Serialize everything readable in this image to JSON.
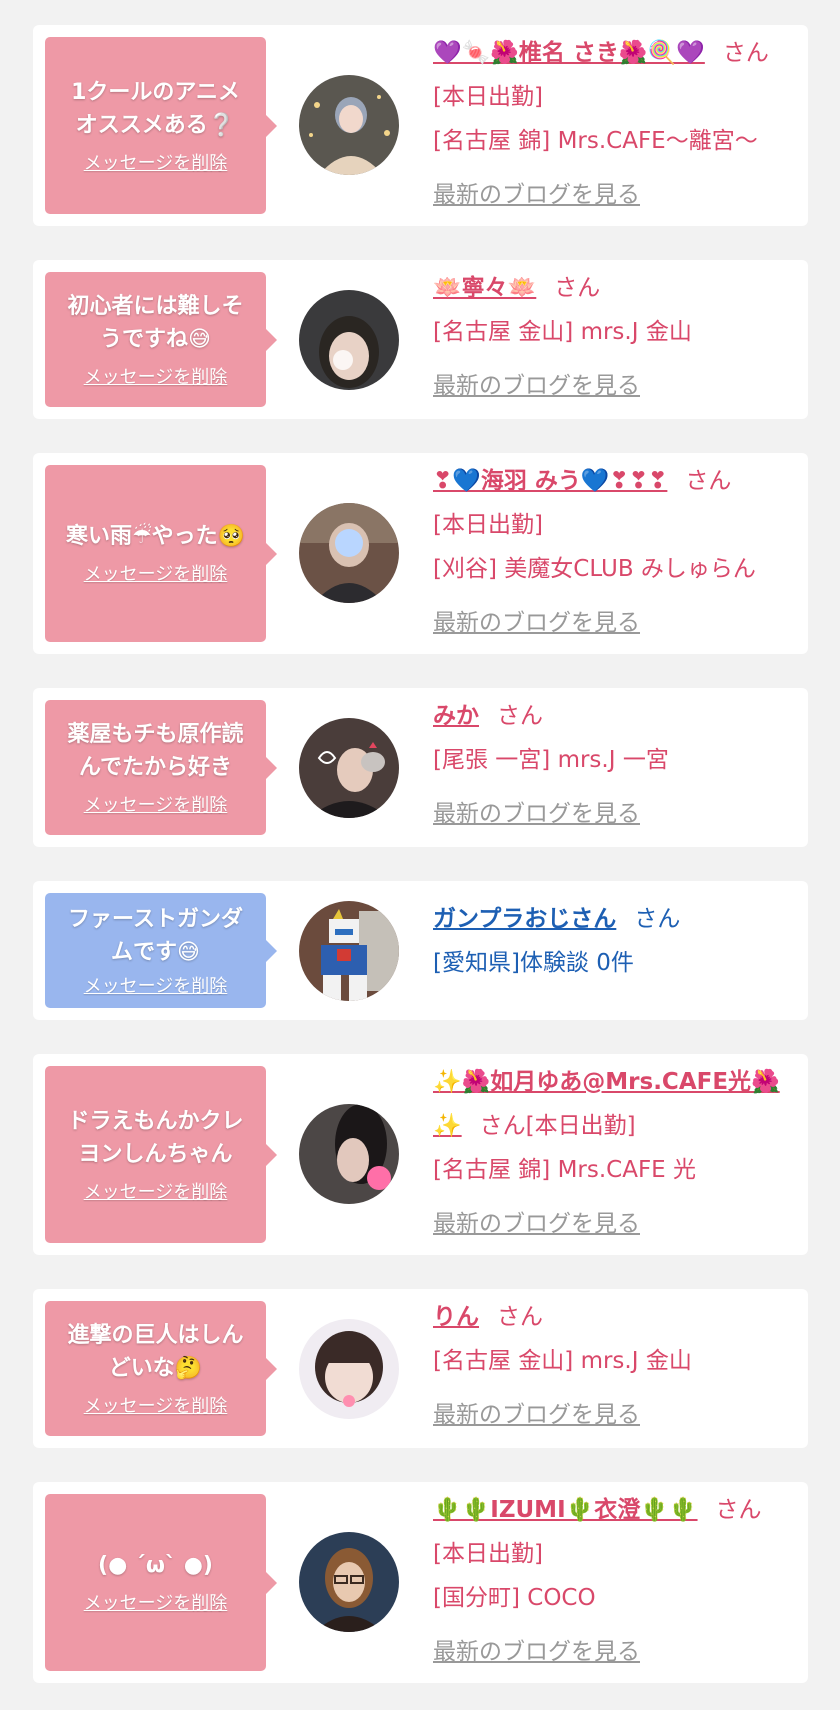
{
  "delete_label": "メッセージを削除",
  "blog_label": "最新のブログを見る",
  "colors": {
    "page_bg": "#f2f2f2",
    "bubble_pink": "#ee99a6",
    "bubble_blue": "#99b6ee",
    "name_pink": "#d9486a",
    "name_blue": "#1d5fb3",
    "blog_gray": "#999999"
  },
  "items": [
    {
      "message": "1クールのアニメオススメある❔",
      "name": "💜🍬🌺椎名 さき🌺🍭💜",
      "honorific": "さん[本日出勤]",
      "store": "[名古屋 錦] Mrs.CAFE〜離宮〜",
      "avatar": "avatar-woman-photo"
    },
    {
      "message": "初心者には難しそうですね😅",
      "name": "🪷寧々🪷",
      "honorific": "さん",
      "store": "[名古屋 金山] mrs.J 金山",
      "avatar": "avatar-woman-photo"
    },
    {
      "message": "寒い雨☔やった🥺",
      "name": "❣💙海羽 みう💙❣❣❣",
      "honorific": "さん",
      "status": "[本日出勤]",
      "store": "[刈谷] 美魔女CLUB みしゅらん",
      "avatar": "avatar-woman-photo"
    },
    {
      "message": "薬屋もチも原作読んでたから好き",
      "name": "みか",
      "honorific": "さん",
      "store": "[尾張 一宮] mrs.J 一宮",
      "avatar": "avatar-woman-photo"
    },
    {
      "message": "ファーストガンダムです😅",
      "name": "ガンプラおじさん",
      "honorific": "さん",
      "store": "[愛知県]体験談 0件",
      "avatar": "avatar-gundam-photo"
    },
    {
      "message": "ドラえもんかクレヨンしんちゃん",
      "name": "✨🌺如月ゆあ@Mrs.CAFE光🌺✨",
      "honorific": "さん[本日出勤]",
      "store": "[名古屋 錦] Mrs.CAFE 光",
      "avatar": "avatar-woman-photo"
    },
    {
      "message": "進撃の巨人はしんどいな🤔",
      "name": "りん",
      "honorific": "さん",
      "store": "[名古屋 金山] mrs.J 金山",
      "avatar": "avatar-woman-photo"
    },
    {
      "message": "(● ´ω` ●)",
      "name": "🌵🌵IZUMI🌵衣澄🌵🌵",
      "honorific": "さん[本日出勤]",
      "store": "[国分町] COCO",
      "avatar": "avatar-woman-photo"
    }
  ]
}
